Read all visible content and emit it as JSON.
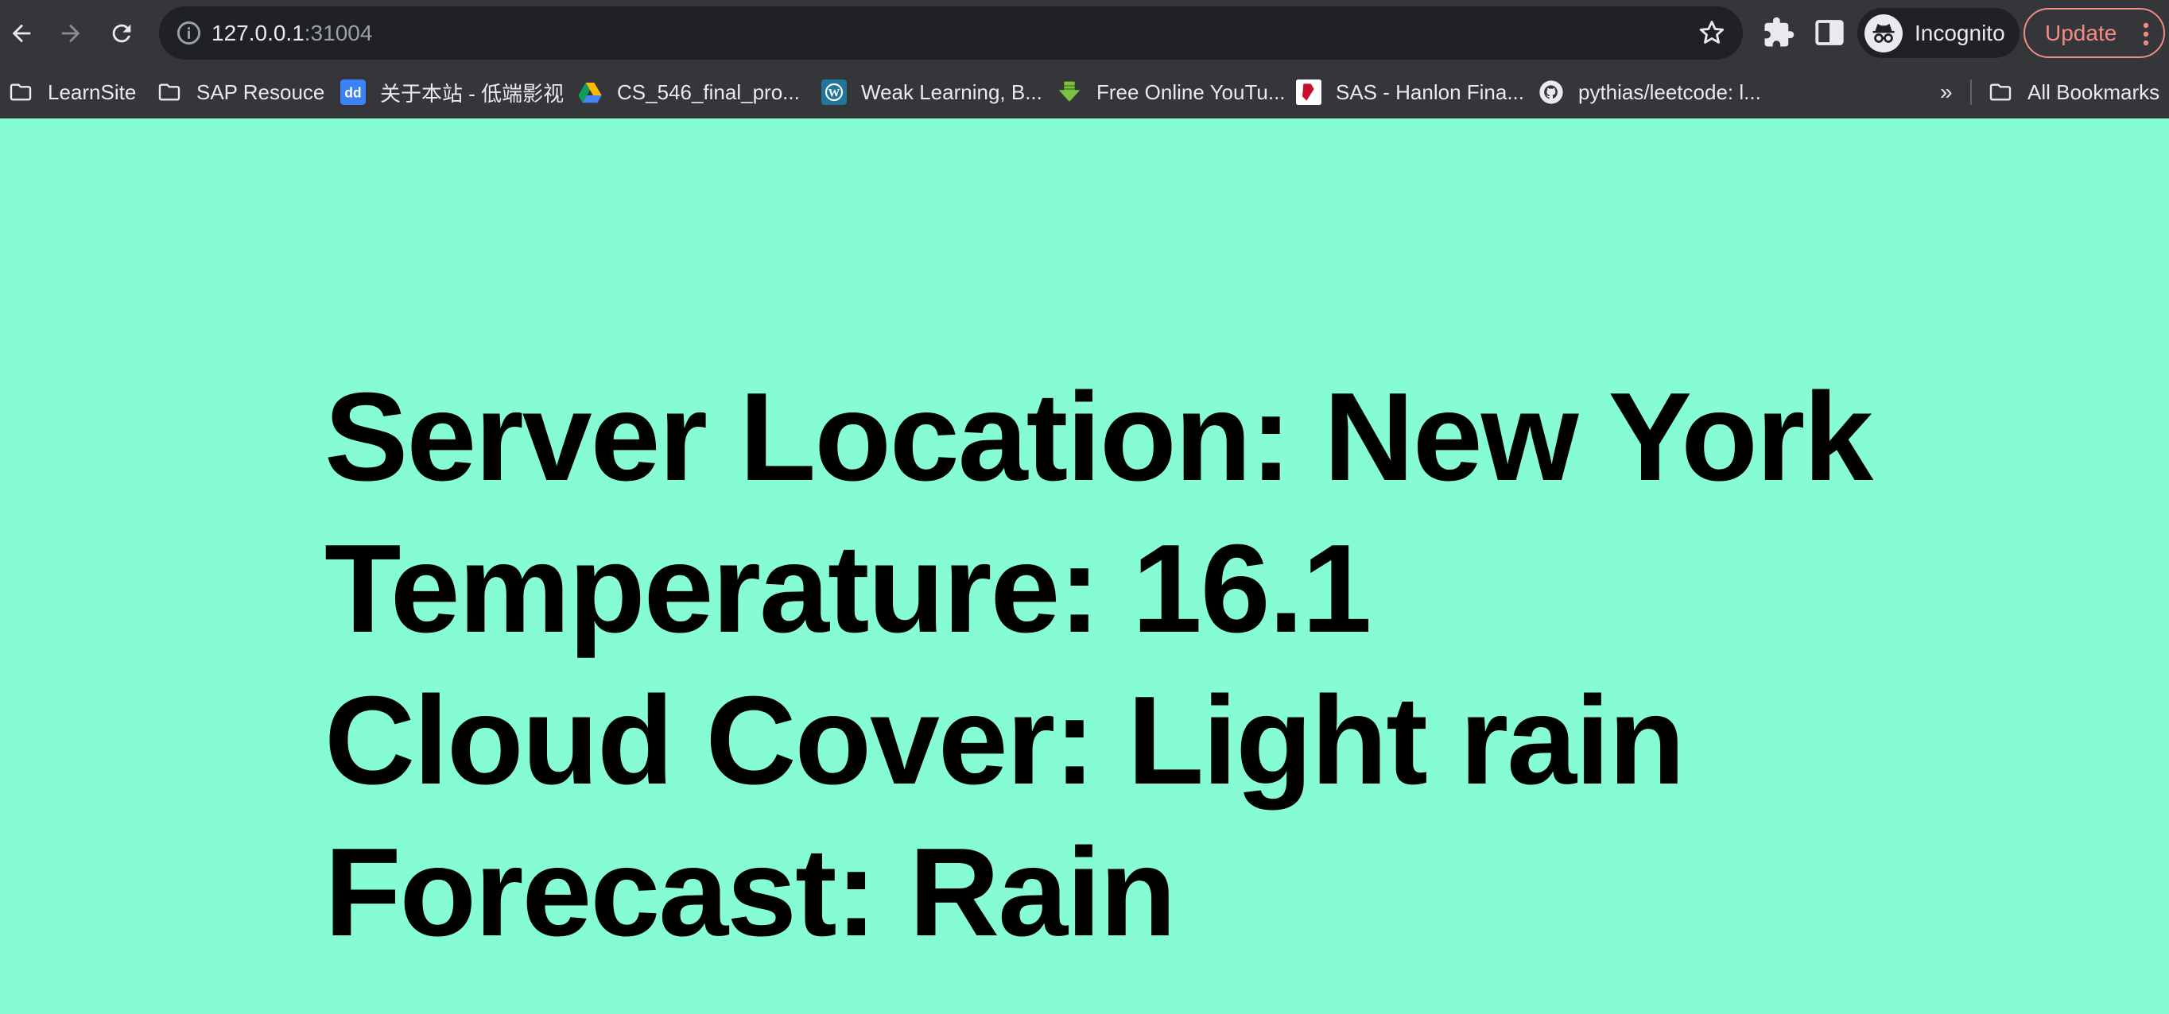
{
  "browser": {
    "url_host": "127.0.0.1",
    "url_port": ":31004",
    "profile_label": "Incognito",
    "update_label": "Update",
    "more_bookmarks": "»",
    "all_bookmarks_label": "All Bookmarks"
  },
  "bookmarks": [
    {
      "label": "LearnSite",
      "icon": "folder-icon"
    },
    {
      "label": "SAP Resouce",
      "icon": "folder-icon"
    },
    {
      "label": "关于本站 - 低端影视",
      "icon": "dd-favicon"
    },
    {
      "label": "CS_546_final_pro...",
      "icon": "google-drive-icon"
    },
    {
      "label": "Weak Learning, B...",
      "icon": "wordpress-icon"
    },
    {
      "label": "Free Online YouTu...",
      "icon": "download-arrow-icon"
    },
    {
      "label": "SAS - Hanlon Fina...",
      "icon": "sas-favicon"
    },
    {
      "label": "pythias/leetcode: l...",
      "icon": "github-icon"
    }
  ],
  "page": {
    "background": "#86fcd4",
    "lines": [
      "Server Location: New York",
      "Temperature: 16.1",
      "Cloud Cover: Light rain",
      "Forecast: Rain"
    ]
  }
}
